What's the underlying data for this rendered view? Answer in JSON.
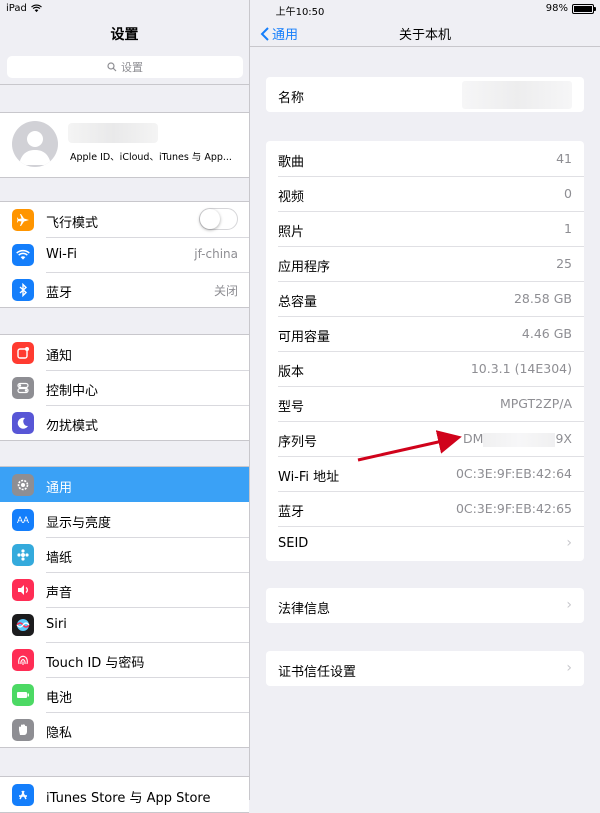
{
  "status_bar": {
    "device": "iPad",
    "time": "上午10:50",
    "battery": "98%",
    "battery_level": 0.98
  },
  "left": {
    "title": "设置",
    "search_placeholder": "设置",
    "profile": {
      "subtitle": "Apple ID、iCloud、iTunes 与 App..."
    },
    "group1": [
      {
        "label": "飞行模式",
        "icon": "airplane-icon",
        "color": "#ff9500",
        "toggle_on": false
      },
      {
        "label": "Wi-Fi",
        "icon": "wifi-icon",
        "color": "#147efb",
        "value": "jf-china"
      },
      {
        "label": "蓝牙",
        "icon": "bluetooth-icon",
        "color": "#147efb",
        "value": "关闭"
      }
    ],
    "group2": [
      {
        "label": "通知",
        "icon": "notifications-icon",
        "color": "#ff3b30"
      },
      {
        "label": "控制中心",
        "icon": "control-center-icon",
        "color": "#8e8e93"
      },
      {
        "label": "勿扰模式",
        "icon": "moon-icon",
        "color": "#5856d6"
      }
    ],
    "group3": [
      {
        "label": "通用",
        "icon": "gear-icon",
        "color": "#8e8e93",
        "selected": true
      },
      {
        "label": "显示与亮度",
        "icon": "display-icon",
        "color": "#147efb"
      },
      {
        "label": "墙纸",
        "icon": "wallpaper-icon",
        "color": "#34aadc"
      },
      {
        "label": "声音",
        "icon": "sound-icon",
        "color": "#ff2d55"
      },
      {
        "label": "Siri",
        "icon": "siri-icon",
        "color": "#1c1c1e"
      },
      {
        "label": "Touch ID 与密码",
        "icon": "fingerprint-icon",
        "color": "#ff2d55"
      },
      {
        "label": "电池",
        "icon": "battery-icon",
        "color": "#4cd964"
      },
      {
        "label": "隐私",
        "icon": "hand-icon",
        "color": "#8e8e93"
      }
    ],
    "group4": [
      {
        "label": "iTunes Store 与 App Store",
        "icon": "app-store-icon",
        "color": "#147efb"
      }
    ]
  },
  "right": {
    "back_label": "通用",
    "title": "关于本机",
    "name_label": "名称",
    "info_rows": [
      {
        "label": "歌曲",
        "value": "41"
      },
      {
        "label": "视频",
        "value": "0"
      },
      {
        "label": "照片",
        "value": "1"
      },
      {
        "label": "应用程序",
        "value": "25"
      },
      {
        "label": "总容量",
        "value": "28.58 GB"
      },
      {
        "label": "可用容量",
        "value": "4.46 GB"
      },
      {
        "label": "版本",
        "value": "10.3.1 (14E304)"
      },
      {
        "label": "型号",
        "value": "MPGT2ZP/A"
      },
      {
        "label": "序列号",
        "value_prefix": "DM",
        "value_suffix": "9X"
      },
      {
        "label": "Wi-Fi 地址",
        "value": "0C:3E:9F:EB:42:64"
      },
      {
        "label": "蓝牙",
        "value": "0C:3E:9F:EB:42:65"
      },
      {
        "label": "SEID",
        "chevron": true
      }
    ],
    "legal_label": "法律信息",
    "cert_label": "证书信任设置"
  },
  "colors": {
    "accent": "#147efb",
    "selected_row": "#3aa1f6",
    "annotation_arrow": "#d0021b"
  }
}
